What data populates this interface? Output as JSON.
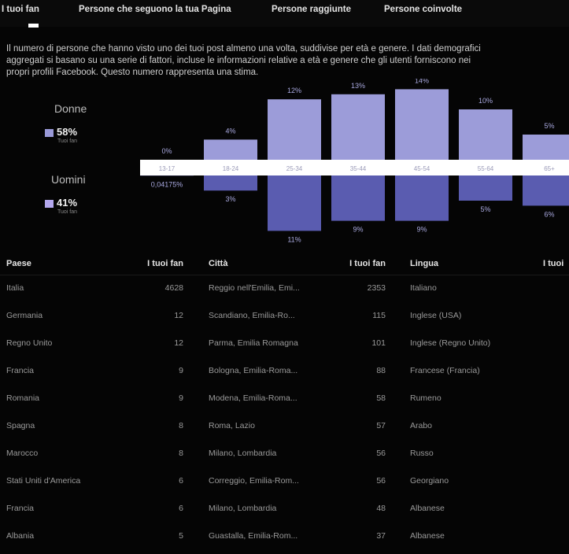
{
  "tabs": [
    {
      "label": "I tuoi fan"
    },
    {
      "label": "Persone che seguono la tua Pagina"
    },
    {
      "label": "Persone raggiunte"
    },
    {
      "label": "Persone coinvolte"
    }
  ],
  "description": [
    "Il numero di persone che hanno visto uno dei tuoi post almeno una volta, suddivise per età e genere. I dati demografici",
    "aggregati si basano su una serie di fattori, incluse le informazioni relative a età e genere che gli utenti forniscono nei",
    "propri profili Facebook. Questo numero rappresenta una stima."
  ],
  "legend": {
    "women": {
      "title": "Donne",
      "pct": "58%",
      "sub": "Tuoi fan",
      "color": "#9a9ad8"
    },
    "men": {
      "title": "Uomini",
      "pct": "41%",
      "sub": "Tuoi fan",
      "color": "#b4a8ee"
    }
  },
  "chart_data": {
    "type": "bar",
    "categories": [
      "13-17",
      "18-24",
      "25-34",
      "35-44",
      "45-54",
      "55-64",
      "65+"
    ],
    "series": [
      {
        "name": "Donne",
        "values": [
          0,
          4,
          12,
          13,
          14,
          10,
          5
        ],
        "labels": [
          "0%",
          "4%",
          "12%",
          "13%",
          "14%",
          "10%",
          "5%"
        ]
      },
      {
        "name": "Uomini",
        "values": [
          0.04175,
          3,
          11,
          9,
          9,
          5,
          6
        ],
        "labels": [
          "0,04175%",
          "3%",
          "11%",
          "9%",
          "9%",
          "5%",
          "6%"
        ]
      }
    ],
    "colors": {
      "women": "#9c9cd9",
      "men": "#5a5cb0"
    }
  },
  "table": {
    "headers": {
      "country": "Paese",
      "country_fans": "I tuoi fan",
      "city": "Città",
      "city_fans": "I tuoi fan",
      "language": "Lingua",
      "language_fans": "I tuoi"
    },
    "rows": [
      {
        "country": "Italia",
        "cf": "4628",
        "city": "Reggio nell'Emilia, Emi...",
        "cif": "2353",
        "lang": "Italiano"
      },
      {
        "country": "Germania",
        "cf": "12",
        "city": "Scandiano, Emilia-Ro...",
        "cif": "115",
        "lang": "Inglese (USA)"
      },
      {
        "country": "Regno Unito",
        "cf": "12",
        "city": "Parma, Emilia Romagna",
        "cif": "101",
        "lang": "Inglese (Regno Unito)"
      },
      {
        "country": "Francia",
        "cf": "9",
        "city": "Bologna, Emilia-Roma...",
        "cif": "88",
        "lang": "Francese (Francia)"
      },
      {
        "country": "Romania",
        "cf": "9",
        "city": "Modena, Emilia-Roma...",
        "cif": "58",
        "lang": "Rumeno"
      },
      {
        "country": "Spagna",
        "cf": "8",
        "city": "Roma, Lazio",
        "cif": "57",
        "lang": "Arabo"
      },
      {
        "country": "Marocco",
        "cf": "8",
        "city": "Milano, Lombardia",
        "cif": "56",
        "lang": "Russo"
      },
      {
        "country": "Stati Uniti d'America",
        "cf": "6",
        "city": "Correggio, Emilia-Rom...",
        "cif": "56",
        "lang": "Georgiano"
      },
      {
        "country": "Francia",
        "cf": "6",
        "city": "Milano, Lombardia",
        "cif": "48",
        "lang": "Albanese"
      },
      {
        "country": "Albania",
        "cf": "5",
        "city": "Guastalla, Emilia-Rom...",
        "cif": "37",
        "lang": "Albanese"
      }
    ]
  }
}
